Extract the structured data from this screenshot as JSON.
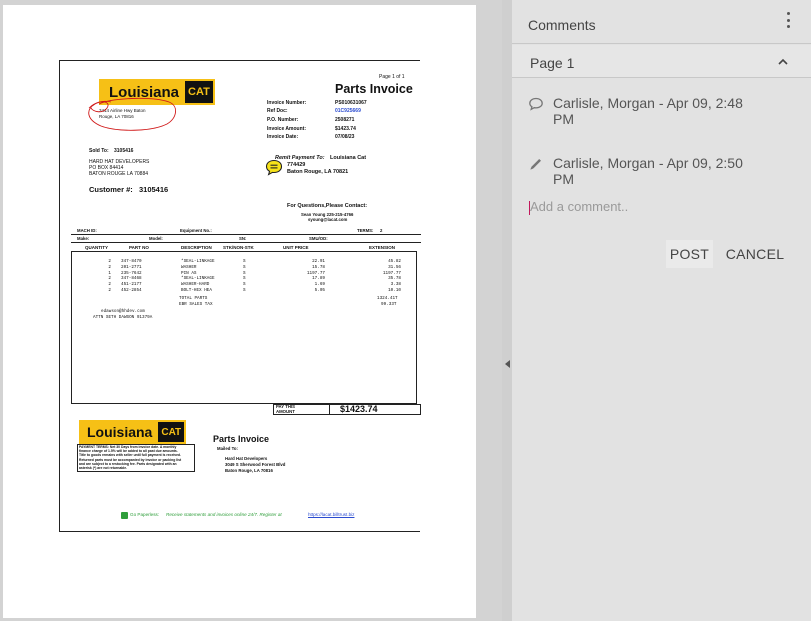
{
  "invoice": {
    "page_label": "Page 1 of 1",
    "brand_name": "Louisiana",
    "brand_badge": "CAT",
    "company_address_line1": "3414 Airline Hwy Baton",
    "company_address_line2": "Rouge, LA 70816",
    "title": "Parts Invoice",
    "meta_labels": [
      "Invoice Number:",
      "Ref Doc:",
      "P.O. Number:",
      "Invoice Amount:",
      "Invoice Date:"
    ],
    "meta_values": [
      "PS010631067",
      "01C925669",
      "2508271",
      "$1423.74",
      "07/08/23"
    ],
    "sold_to_label": "Sold To:",
    "sold_to_id": "3105416",
    "sold_to_lines": [
      "HARD HAT DEVELOPERS",
      "PO BOX 84414",
      "BATON ROUGE LA 70884"
    ],
    "customer_label": "Customer #:",
    "customer_number": "3105416",
    "remit_label": "Remit Payment To:",
    "remit_name": "Louisiana Cat",
    "remit_box": "774429",
    "remit_city": "Baton Rouge, LA 70821",
    "questions_label": "For Questions,Please Contact:",
    "contact_name": "Sean Young 225-215-4766",
    "contact_email": "syoung@lacat.com",
    "row_labels": {
      "mach_id": "MACH ID:",
      "equipment_no": "Equipment No.:",
      "terms": "TERMS:",
      "terms_value": "2",
      "make": "Make:",
      "model": "Model:",
      "sn": "SN:",
      "smu": "SMU/OD:"
    },
    "columns": [
      "QUANTITY",
      "PART NO",
      "DESCRIPTION",
      "STK/NON-STK",
      "UNIT PRICE",
      "EXTENSION"
    ],
    "lines": [
      {
        "qty": "2",
        "part": "347-8470",
        "desc": "*SEAL-LINKAGE",
        "stk": "S",
        "unit": "22.91",
        "ext": "45.82"
      },
      {
        "qty": "2",
        "part": "201-2771",
        "desc": "WASHER",
        "stk": "S",
        "unit": "15.78",
        "ext": "31.56"
      },
      {
        "qty": "1",
        "part": "235-7642",
        "desc": "PIN AS",
        "stk": "S",
        "unit": "1197.77",
        "ext": "1197.77"
      },
      {
        "qty": "2",
        "part": "347-8468",
        "desc": "*SEAL-LINKAGE",
        "stk": "S",
        "unit": "17.89",
        "ext": "35.78"
      },
      {
        "qty": "2",
        "part": "451-2177",
        "desc": "WASHER-HARD",
        "stk": "S",
        "unit": "1.69",
        "ext": "3.38"
      },
      {
        "qty": "2",
        "part": "452-2854",
        "desc": "BOLT-HEX HEA",
        "stk": "S",
        "unit": "5.05",
        "ext": "10.10"
      }
    ],
    "totals": [
      {
        "label": "TOTAL PARTS",
        "value": "1324.41T"
      },
      {
        "label": "EBR SALES TAX",
        "value": "99.33T"
      }
    ],
    "notes": [
      "edawson@hhdev.com",
      "ATTN SETH DAWSON 91379A"
    ],
    "pay_label_1": "PAY THIS",
    "pay_label_2": "AMOUNT",
    "pay_amount": "$1423.74",
    "stub_title": "Parts Invoice",
    "stub_mailed_to": "Mailed To:",
    "stub_address": [
      "Hard Hat Developers",
      "3049 S Sherwood Forest Blvd",
      "Baton Rouge, LA 70816"
    ],
    "terms_text": [
      "PAYMENT TERMS: Net 30 Days from invoice date. A monthly",
      "finance charge of 1.5% will be added to all past due amounts.",
      "Title to goods remains with seller until full payment is received.",
      "Returned parts must be accompanied by invoice or packing list",
      "and are subject to a restocking fee. Parts designated with an",
      "asterisk (*) are not returnable."
    ],
    "paperless_label": "Go Paperless:",
    "paperless_text": "Receive statements and invoices online 24/7. Register at",
    "paperless_link": "https://lacat.billtrust.biz",
    "annotation_icon": "comment-bubble-icon"
  },
  "panel": {
    "title": "Comments",
    "section_title": "Page 1",
    "comments": [
      {
        "icon": "speech-bubble-icon",
        "text": "Carlisle, Morgan - Apr 09, 2:48 PM"
      },
      {
        "icon": "pencil-icon",
        "text": "Carlisle, Morgan - Apr 09, 2:50 PM"
      }
    ],
    "add_placeholder": "Add a comment..",
    "post_label": "POST",
    "cancel_label": "CANCEL"
  },
  "colors": {
    "accent": "#c2185b",
    "brand_yellow": "#f6c016",
    "link_blue": "#2a4bd0",
    "annotation_red": "#d01818"
  }
}
